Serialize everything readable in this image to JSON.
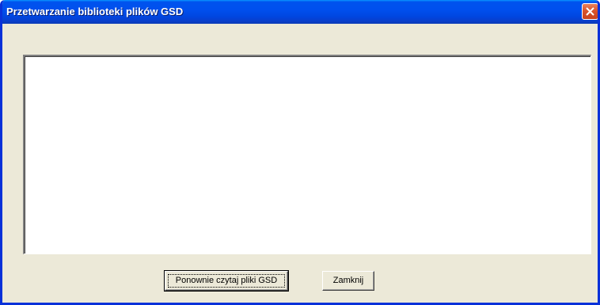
{
  "window": {
    "title": "Przetwarzanie biblioteki plików GSD",
    "close_icon": "close-icon"
  },
  "log": {
    "content": ""
  },
  "buttons": {
    "reload_label": "Ponownie czytaj pliki GSD",
    "close_label": "Zamknij"
  },
  "colors": {
    "titlebar": "#0053ee",
    "window_bg": "#ece9d8",
    "close_button": "#d9542c"
  }
}
